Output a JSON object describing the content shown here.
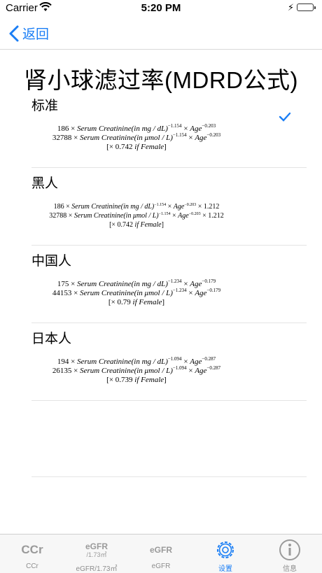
{
  "status_bar": {
    "carrier": "Carrier",
    "time": "5:20 PM"
  },
  "nav": {
    "back_label": "返回",
    "accent_color": "#1a7ef5"
  },
  "page": {
    "title": "肾小球滤过率(MDRD公式)"
  },
  "sections": [
    {
      "heading": "标准",
      "selected": true,
      "formula_lines": [
        {
          "coef": "186",
          "unit": "mg / dL",
          "exp1": "−1.154",
          "exp2": "−0.203",
          "extra": ""
        },
        {
          "coef": "32788",
          "unit": "μmol / L",
          "exp1": "−1.154",
          "exp2": "−0.203",
          "extra": ""
        }
      ],
      "female_factor": "0.742"
    },
    {
      "heading": "黑人",
      "selected": false,
      "formula_lines": [
        {
          "coef": "186",
          "unit": "mg / dL",
          "exp1": "−1.154",
          "exp2": "−0.203",
          "extra": "× 1.212"
        },
        {
          "coef": "32788",
          "unit": "μmol / L",
          "exp1": "−1.154",
          "exp2": "−0.203",
          "extra": "× 1.212"
        }
      ],
      "female_factor": "0.742"
    },
    {
      "heading": "中国人",
      "selected": false,
      "formula_lines": [
        {
          "coef": "175",
          "unit": "mg / dL",
          "exp1": "−1.234",
          "exp2": "−0.179",
          "extra": ""
        },
        {
          "coef": "44153",
          "unit": "μmol / L",
          "exp1": "−1.234",
          "exp2": "−0.179",
          "extra": ""
        }
      ],
      "female_factor": "0.79"
    },
    {
      "heading": "日本人",
      "selected": false,
      "formula_lines": [
        {
          "coef": "194",
          "unit": "mg / dL",
          "exp1": "−1.094",
          "exp2": "−0.287",
          "extra": ""
        },
        {
          "coef": "26135",
          "unit": "μmol / L",
          "exp1": "−1.094",
          "exp2": "−0.287",
          "extra": ""
        }
      ],
      "female_factor": "0.739"
    }
  ],
  "formula_text": {
    "times": "×",
    "serum": "Serum Creatinine",
    "in": "in",
    "age": "Age",
    "if": "if",
    "female": "Female"
  },
  "tabbar": {
    "tabs": [
      {
        "label": "CCr",
        "icon_text": "CCr",
        "icon_sub": "",
        "active": false
      },
      {
        "label": "eGFR/1.73㎡",
        "icon_text": "eGFR",
        "icon_sub": "/1.73㎡",
        "active": false
      },
      {
        "label": "eGFR",
        "icon_text": "eGFR",
        "icon_sub": "",
        "active": false
      },
      {
        "label": "设置",
        "icon_text": "",
        "icon_sub": "",
        "icon": "gear-icon",
        "active": true
      },
      {
        "label": "信息",
        "icon_text": "",
        "icon_sub": "",
        "icon": "info-icon",
        "active": false
      }
    ]
  }
}
